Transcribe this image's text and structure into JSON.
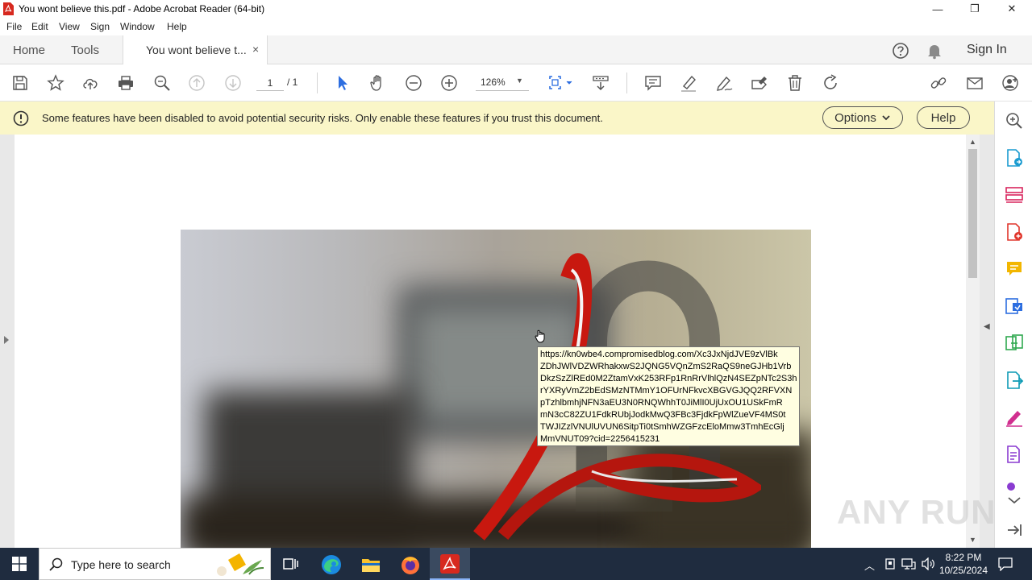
{
  "window": {
    "title": "You wont believe this.pdf - Adobe Acrobat Reader (64-bit)",
    "minimize": "—",
    "maximize": "❐",
    "close": "✕"
  },
  "menu": [
    "File",
    "Edit",
    "View",
    "Sign",
    "Window",
    "Help"
  ],
  "tabs": {
    "home": "Home",
    "tools": "Tools",
    "document": "You wont believe t...",
    "close": "×",
    "sign_in": "Sign In"
  },
  "toolbar": {
    "page_current": "1",
    "page_total": "/ 1",
    "zoom": "126%"
  },
  "banner": {
    "message": "Some features have been disabled to avoid potential security risks. Only enable these features if you trust this document.",
    "options": "Options",
    "help": "Help"
  },
  "tooltip": {
    "lines": [
      "https://kn0wbe4.compromisedblog.com/Xc3JxNjdJVE9zVlBk",
      "ZDhJWlVDZWRhakxwS2JQNG5VQnZmS2RaQS9neGJHb1Vrb",
      "DkzSzZlREd0M2ZtamVxK253RFp1RnRrVlhlQzN4SEZpNTc2S3h",
      "rYXRyVmZ2bEdSMzNTMmY1OFUrNFkvcXBGVGJQQ2RFVXN",
      "pTzhlbmhjNFN3aEU3N0RNQWhhT0JiMlI0UjUxOU1USkFmR",
      "mN3cC82ZU1FdkRUbjJodkMwQ3FBc3FjdkFpWlZueVF4MS0t",
      "TWJIZzlVNUlUVUN6SitpTi0tSmhWZGFzcEloMmw3TmhEcGlj",
      "MmVNUT09?cid=2256415231"
    ]
  },
  "watermark": "ANY RUN",
  "taskbar": {
    "search_placeholder": "Type here to search",
    "time": "8:22 PM",
    "date": "10/25/2024"
  },
  "colors": {
    "acrobat_red": "#d7291f",
    "banner_bg": "#faf6c8",
    "accent_blue": "#2d6ee0",
    "taskbar": "#1f2c3f"
  }
}
